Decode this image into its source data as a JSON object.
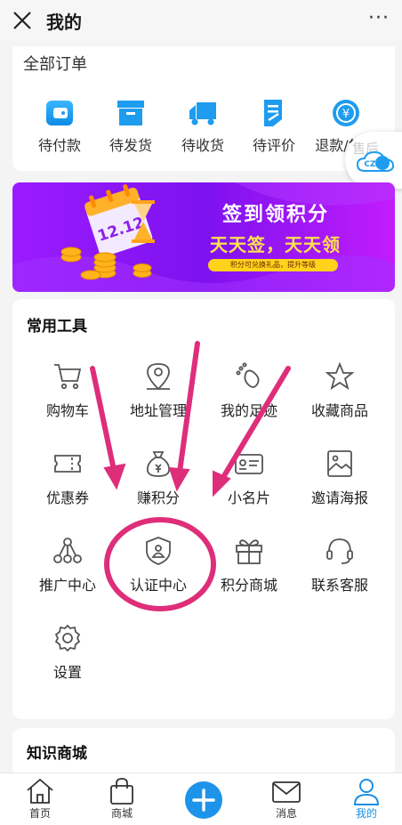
{
  "header": {
    "title": "我的",
    "more": "···"
  },
  "orders": {
    "title": "全部订单",
    "items": [
      {
        "label": "待付款",
        "icon": "wallet-icon"
      },
      {
        "label": "待发货",
        "icon": "box-icon"
      },
      {
        "label": "待收货",
        "icon": "truck-icon"
      },
      {
        "label": "待评价",
        "icon": "review-icon"
      },
      {
        "label": "退款/售后",
        "icon": "refund-icon"
      }
    ]
  },
  "float_service": {
    "overlay_text": "售后"
  },
  "banner": {
    "title": "签到领积分",
    "subtitle": "天天签，天天领",
    "pill": "积分可兑换礼品，提升等级",
    "date": "12.12"
  },
  "tools": {
    "title": "常用工具",
    "items": [
      {
        "label": "购物车",
        "icon": "cart-icon"
      },
      {
        "label": "地址管理",
        "icon": "location-icon"
      },
      {
        "label": "我的足迹",
        "icon": "footprint-icon"
      },
      {
        "label": "收藏商品",
        "icon": "star-icon"
      },
      {
        "label": "优惠券",
        "icon": "coupon-icon"
      },
      {
        "label": "赚积分",
        "icon": "money-bag-icon"
      },
      {
        "label": "小名片",
        "icon": "card-icon"
      },
      {
        "label": "邀请海报",
        "icon": "poster-icon"
      },
      {
        "label": "推广中心",
        "icon": "network-icon"
      },
      {
        "label": "认证中心",
        "icon": "shield-icon"
      },
      {
        "label": "积分商城",
        "icon": "gift-icon"
      },
      {
        "label": "联系客服",
        "icon": "headset-icon"
      },
      {
        "label": "设置",
        "icon": "settings-icon"
      }
    ]
  },
  "knowledge": {
    "title": "知识商城"
  },
  "tabbar": {
    "items": [
      {
        "label": "首页",
        "icon": "home-icon"
      },
      {
        "label": "商城",
        "icon": "shopping-bag-icon"
      },
      {
        "label": "",
        "icon": "plus-icon"
      },
      {
        "label": "消息",
        "icon": "mail-icon"
      },
      {
        "label": "我的",
        "icon": "user-icon"
      }
    ],
    "active": "我的"
  },
  "colors": {
    "accent": "#1a8fe3",
    "icon_blue": "#1e9cf0",
    "annotation": "#de2e7a",
    "banner_start": "#9b1bff",
    "banner_yellow": "#ffe14d"
  }
}
